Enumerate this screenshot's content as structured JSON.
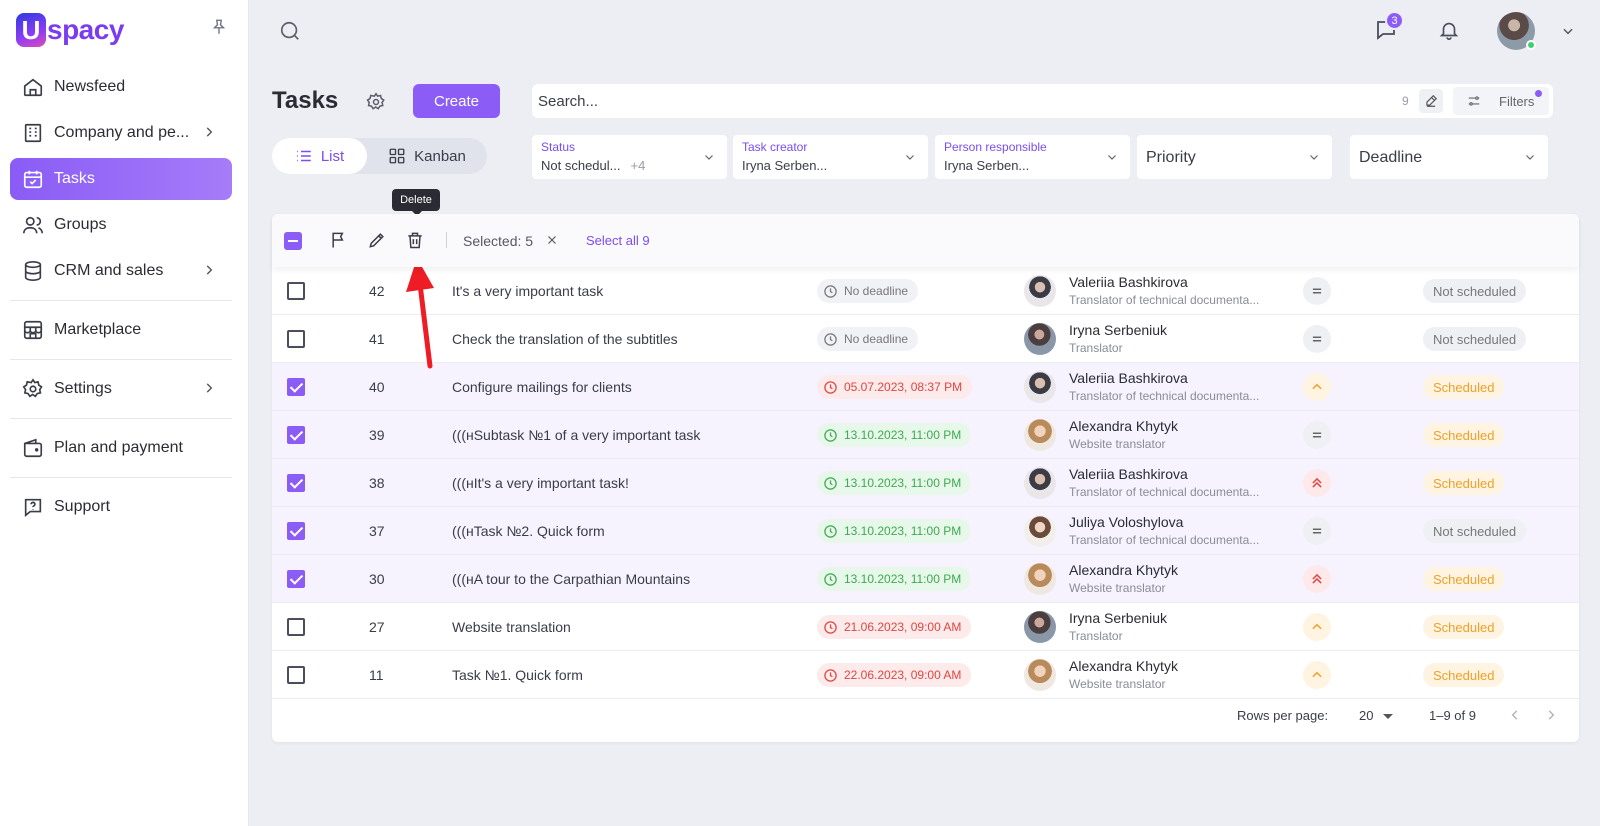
{
  "sidebar": {
    "logo": {
      "mark": "U",
      "text": "spacy"
    },
    "items": [
      {
        "label": "Newsfeed",
        "icon": "home-icon"
      },
      {
        "label": "Company and pe...",
        "icon": "building-icon"
      },
      {
        "label": "Tasks",
        "icon": "calendar-check-icon"
      },
      {
        "label": "Groups",
        "icon": "users-icon"
      },
      {
        "label": "CRM and sales",
        "icon": "database-icon"
      },
      {
        "label": "Marketplace",
        "icon": "store-icon"
      },
      {
        "label": "Settings",
        "icon": "gear-icon"
      },
      {
        "label": "Plan and payment",
        "icon": "wallet-icon"
      },
      {
        "label": "Support",
        "icon": "help-icon"
      }
    ]
  },
  "topbar": {
    "chat_badge": "3"
  },
  "header": {
    "title": "Tasks",
    "create_label": "Create",
    "view_list": "List",
    "view_kanban": "Kanban",
    "search_placeholder": "Search...",
    "search_count": "9",
    "filters_label": "Filters"
  },
  "filters": {
    "status": {
      "label": "Status",
      "value": "Not schedul...",
      "extra": "+4"
    },
    "creator": {
      "label": "Task creator",
      "value": "Iryna Serben..."
    },
    "responsible": {
      "label": "Person responsible",
      "value": "Iryna Serben..."
    },
    "priority": {
      "placeholder": "Priority"
    },
    "deadline": {
      "placeholder": "Deadline"
    }
  },
  "tooltip": "Delete",
  "toolbar": {
    "selected_text": "Selected: 5",
    "select_all": "Select all 9"
  },
  "rows": [
    {
      "id": "42",
      "name": "It's a very important task",
      "deadline": "No deadline",
      "person": "Valeriia Bashkirova",
      "role": "Translator of technical documenta...",
      "status": "Not scheduled",
      "checked": false
    },
    {
      "id": "41",
      "name": "Check the translation of the subtitles",
      "deadline": "No deadline",
      "person": "Iryna Serbeniuk",
      "role": "Translator",
      "status": "Not scheduled",
      "checked": false
    },
    {
      "id": "40",
      "name": "Configure mailings for clients",
      "deadline": "05.07.2023, 08:37 PM",
      "person": "Valeriia Bashkirova",
      "role": "Translator of technical documenta...",
      "status": "Scheduled",
      "checked": true
    },
    {
      "id": "39",
      "name": "(((нSubtask №1 of a very important task",
      "deadline": "13.10.2023, 11:00 PM",
      "person": "Alexandra Khytyk",
      "role": "Website translator",
      "status": "Scheduled",
      "checked": true
    },
    {
      "id": "38",
      "name": "(((нIt's a very important task!",
      "deadline": "13.10.2023, 11:00 PM",
      "person": "Valeriia Bashkirova",
      "role": "Translator of technical documenta...",
      "status": "Scheduled",
      "checked": true
    },
    {
      "id": "37",
      "name": "(((нTask №2. Quick form",
      "deadline": "13.10.2023, 11:00 PM",
      "person": "Juliya Voloshylova",
      "role": "Translator of technical documenta...",
      "status": "Not scheduled",
      "checked": true
    },
    {
      "id": "30",
      "name": "(((нA tour to the Carpathian Mountains",
      "deadline": "13.10.2023, 11:00 PM",
      "person": "Alexandra Khytyk",
      "role": "Website translator",
      "status": "Scheduled",
      "checked": true
    },
    {
      "id": "27",
      "name": "Website translation",
      "deadline": "21.06.2023, 09:00 AM",
      "person": "Iryna Serbeniuk",
      "role": "Translator",
      "status": "Scheduled",
      "checked": false
    },
    {
      "id": "11",
      "name": "Task №1. Quick form",
      "deadline": "22.06.2023, 09:00 AM",
      "person": "Alexandra Khytyk",
      "role": "Website translator",
      "status": "Scheduled",
      "checked": false
    }
  ],
  "pager": {
    "rows_per_page_label": "Rows per page:",
    "rows_per_page": "20",
    "range": "1–9 of 9"
  },
  "colors": {
    "accent": "#8b5cf6",
    "overdue": "#e0463f",
    "on_time": "#3daa4f",
    "scheduled": "#f0a028"
  }
}
